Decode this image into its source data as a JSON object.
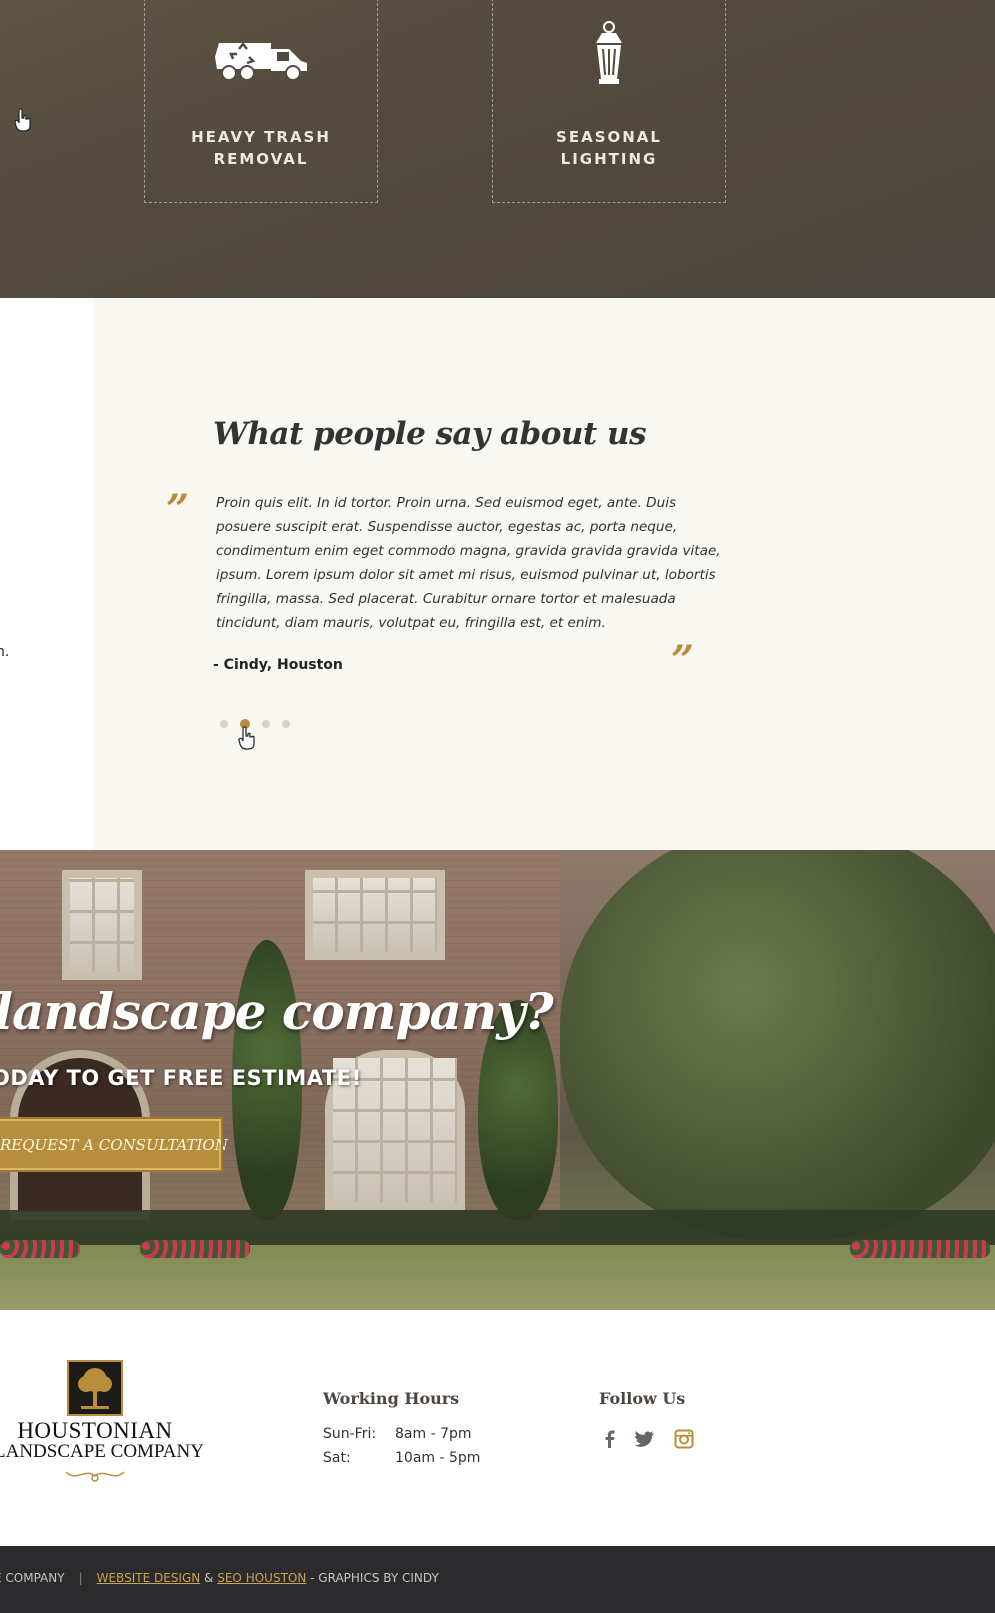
{
  "services": {
    "items": [
      {
        "label": "HEAVY TRASH REMOVAL",
        "icon": "trash-truck-icon"
      },
      {
        "label": "SEASONAL LIGHTING",
        "icon": "lantern-icon"
      }
    ]
  },
  "testimonials": {
    "heading": "What people say about us",
    "quote": "Proin quis elit. In id tortor. Proin urna. Sed euismod eget, ante. Duis posuere suscipit erat. Suspendisse auctor, egestas ac, porta neque, condimentum enim eget commodo magna, gravida gravida gravida vitae, ipsum. Lorem ipsum dolor sit amet mi risus, euismod pulvinar ut, lobortis fringilla, massa. Sed placerat. Curabitur ornare tortor et malesuada tincidunt, diam mauris, volutpat eu, fringilla est, et enim.",
    "author": "- Cindy, Houston",
    "open_quote": "”",
    "close_quote": "”",
    "active_dot": 2,
    "dot_count": 4,
    "left_fragment": "n."
  },
  "cta": {
    "title": "landscape company?",
    "subtitle": "ODAY TO GET FREE ESTIMATE!",
    "button_label": "REQUEST A CONSULTATION"
  },
  "footer": {
    "logo_line1": "HOUSTONIAN",
    "logo_line2": "LANDSCAPE COMPANY",
    "hours_title": "Working Hours",
    "hours": [
      {
        "day": "Sun-Fri:",
        "time": "8am - 7pm"
      },
      {
        "day": "Sat:",
        "time": "10am - 5pm"
      }
    ],
    "follow_title": "Follow Us",
    "social": [
      "facebook-icon",
      "twitter-icon",
      "instagram-icon"
    ]
  },
  "bottom_bar": {
    "company": "E COMPANY",
    "separator": "|",
    "link1": "WEBSITE DESIGN",
    "amp": "&",
    "link2": "SEO HOUSTON",
    "credit": "- GRAPHICS BY CINDY"
  },
  "colors": {
    "accent": "#b78f3c",
    "services_bg": "#524a3e",
    "testimonial_bg": "#f8f7f2",
    "bottom_bar_bg": "#2b2a2c"
  }
}
